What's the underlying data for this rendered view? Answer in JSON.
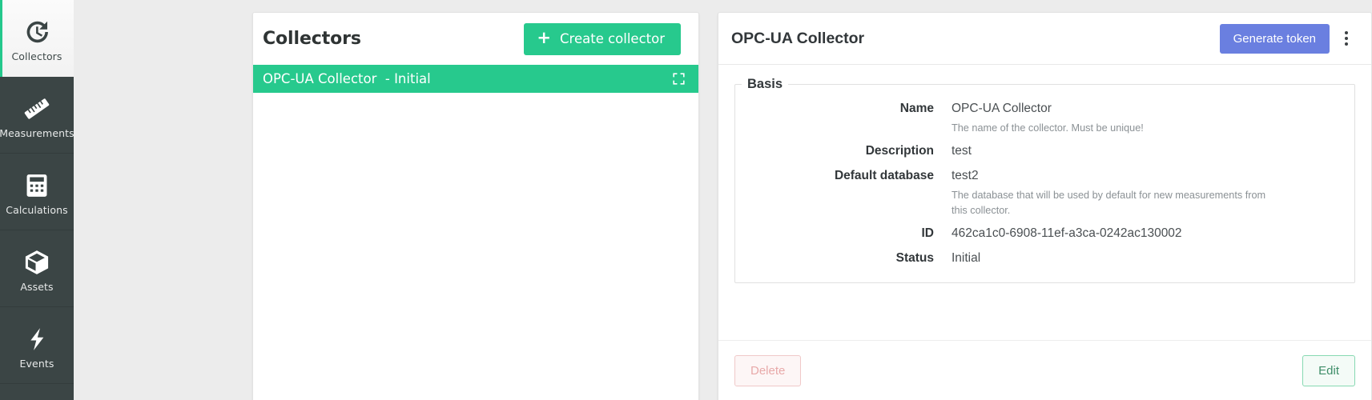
{
  "theme": {
    "accent_green": "#27c98d",
    "sidebar_bg": "#3b4545",
    "page_bg": "#ececec",
    "generate_token_blue": "#6a7fe0",
    "delete_red": "#e8a9a9",
    "edit_green": "#3e8d68"
  },
  "sidebar": {
    "items": [
      {
        "label": "Collectors",
        "icon": "history-clock-icon",
        "active": true
      },
      {
        "label": "Measurements",
        "icon": "ruler-icon",
        "active": false
      },
      {
        "label": "Calculations",
        "icon": "calculator-icon",
        "active": false
      },
      {
        "label": "Assets",
        "icon": "cube-box-icon",
        "active": false
      },
      {
        "label": "Events",
        "icon": "lightning-bolt-icon",
        "active": false
      }
    ]
  },
  "collectors_panel": {
    "title": "Collectors",
    "create_button": {
      "label": "Create collector",
      "icon": "plus-icon"
    },
    "rows": [
      {
        "name": "OPC-UA Collector",
        "status": "Initial",
        "display": "OPC-UA Collector  - Initial",
        "selected": true,
        "expand_icon": "expand-fullscreen-icon"
      }
    ]
  },
  "detail_panel": {
    "title": "OPC-UA Collector",
    "generate_token_label": "Generate token",
    "kebab_icon": "more-vertical-icon",
    "basis": {
      "legend": "Basis",
      "fields": [
        {
          "label": "Name",
          "value": "OPC-UA Collector",
          "help": "The name of the collector. Must be unique!"
        },
        {
          "label": "Description",
          "value": "test",
          "help": ""
        },
        {
          "label": "Default database",
          "value": "test2",
          "help": "The database that will be used by default for new measurements from this collector."
        },
        {
          "label": "ID",
          "value": "462ca1c0-6908-11ef-a3ca-0242ac130002",
          "help": ""
        },
        {
          "label": "Status",
          "value": "Initial",
          "help": ""
        }
      ]
    },
    "footer": {
      "delete_label": "Delete",
      "edit_label": "Edit"
    }
  }
}
